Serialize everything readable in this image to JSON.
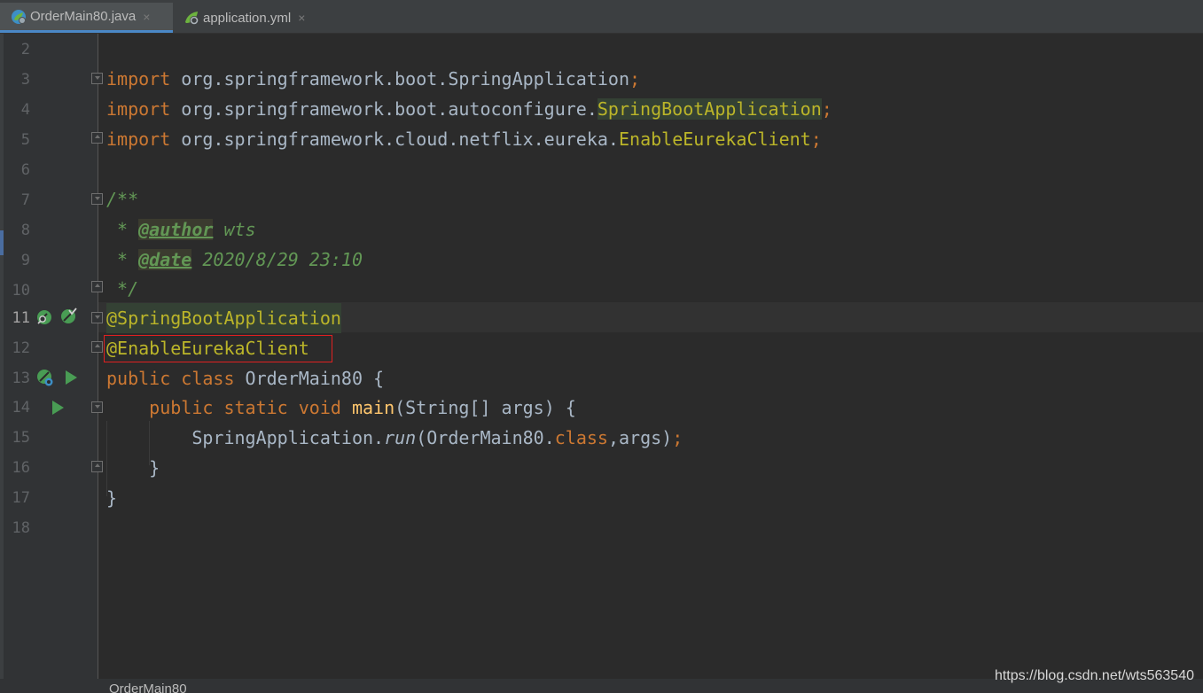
{
  "tabs": [
    {
      "label": "OrderMain80.java",
      "icon": "spring-class-icon",
      "active": true
    },
    {
      "label": "application.yml",
      "icon": "yaml-config-icon",
      "active": false
    }
  ],
  "tab_close_glyph": "×",
  "line_numbers": [
    "2",
    "3",
    "4",
    "5",
    "6",
    "7",
    "8",
    "9",
    "10",
    "11",
    "12",
    "13",
    "14",
    "15",
    "16",
    "17",
    "18"
  ],
  "code": {
    "l3": {
      "kw": "import",
      "pkg": " org.springframework.boot.SpringApplication",
      "semi": ";"
    },
    "l4": {
      "kw": "import",
      "pkg": " org.springframework.boot.autoconfigure.",
      "cls": "SpringBootApplication",
      "semi": ";"
    },
    "l5": {
      "kw": "import",
      "pkg": " org.springframework.cloud.netflix.eureka.",
      "cls": "EnableEurekaClient",
      "semi": ";"
    },
    "l7": "/**",
    "l8": {
      "star": " * ",
      "tag": "@author",
      "val": " wts"
    },
    "l9": {
      "star": " * ",
      "tag": "@date",
      "val": " 2020/8/29 23:10"
    },
    "l10": " */",
    "l11": "@SpringBootApplication",
    "l12": "@EnableEurekaClient",
    "l13": {
      "kw": "public class",
      "rest": " OrderMain80 {"
    },
    "l14": {
      "indent": "    ",
      "kw": "public static void",
      "fn": "main",
      "rest": "(String[] args) {"
    },
    "l15": {
      "indent": "        ",
      "a": "SpringApplication.",
      "run": "run",
      "b": "(OrderMain80.",
      "kw": "class",
      "c": ",args)",
      "semi": ";"
    },
    "l16": "    }",
    "l17": "}"
  },
  "breadcrumb": "OrderMain80",
  "watermark": "https://blog.csdn.net/wts563540",
  "colors": {
    "keyword": "#cc7832",
    "annotation": "#bbb529",
    "comment": "#629755",
    "method": "#ffc66d",
    "text": "#a9b7c6",
    "highlight_box": "#e02020"
  }
}
